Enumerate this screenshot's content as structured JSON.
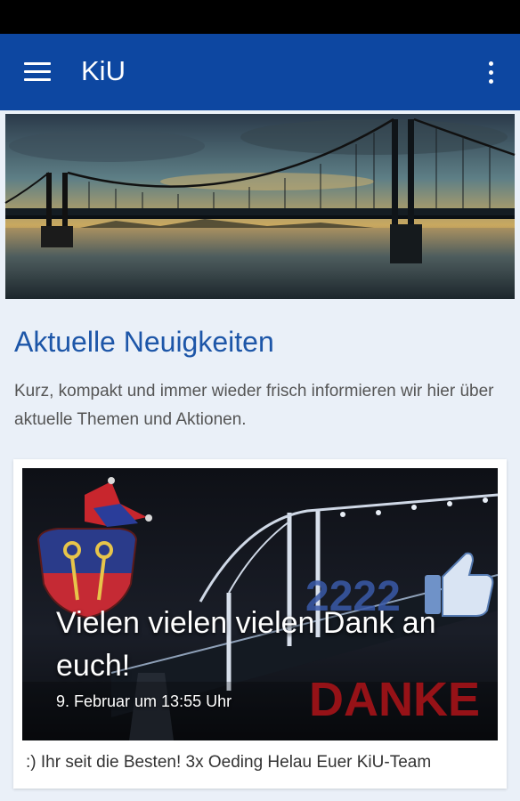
{
  "app_bar": {
    "title": "KiU",
    "menu_icon": "hamburger-menu-icon",
    "overflow_icon": "more-vert-icon",
    "color": "#0d47a1"
  },
  "section": {
    "title": "Aktuelle Neuigkeiten",
    "description": "Kurz, kompakt und immer wieder frisch informieren wir hier über aktuelle Themen und Aktionen.",
    "title_color": "#1d56a8"
  },
  "news_card": {
    "headline": "Vielen vielen vielen Dank an euch!",
    "date": "9. Februar um 13:55 Uhr",
    "teaser": ":) Ihr seit die Besten! 3x Oeding Helau Euer KiU-Team",
    "image_text_danke": "DANKE",
    "image_text_number": "2222"
  }
}
